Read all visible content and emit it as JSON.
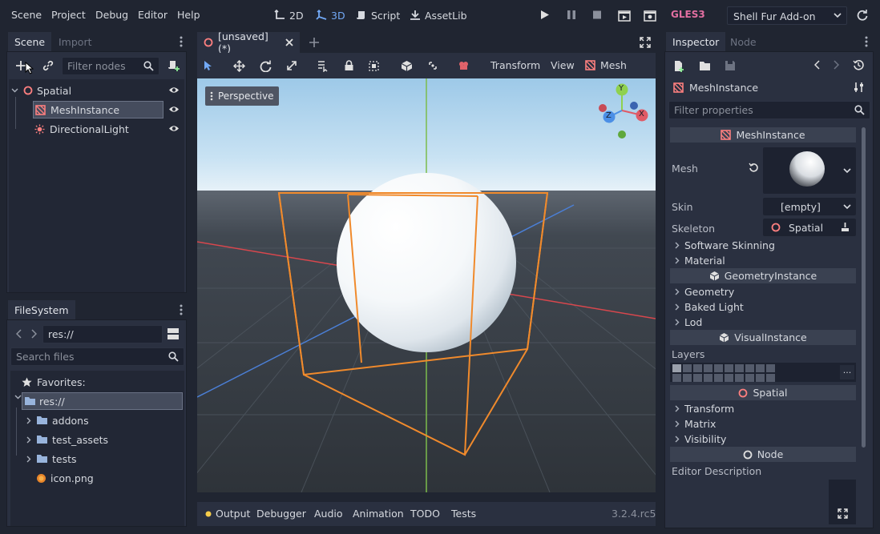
{
  "menu": [
    "Scene",
    "Project",
    "Debug",
    "Editor",
    "Help"
  ],
  "modes": {
    "m2d": "2D",
    "m3d": "3D",
    "script": "Script",
    "assetlib": "AssetLib"
  },
  "renderer": "GLES3",
  "plugin": "Shell Fur Add-on",
  "scene_dock": {
    "tabs": [
      "Scene",
      "Import"
    ],
    "filter_placeholder": "Filter nodes",
    "nodes": [
      "Spatial",
      "MeshInstance",
      "DirectionalLight"
    ]
  },
  "filesystem": {
    "tab": "FileSystem",
    "path": "res://",
    "search_placeholder": "Search files",
    "favorites": "Favorites:",
    "root": "res://",
    "items": [
      "addons",
      "test_assets",
      "tests",
      "icon.png"
    ]
  },
  "editor_tab": "[unsaved](*)",
  "viewport_menu": {
    "transform": "Transform",
    "view": "View",
    "mesh": "Mesh"
  },
  "perspective": "Perspective",
  "gizmo_axes": {
    "x": "X",
    "y": "Y",
    "z": "Z"
  },
  "bottom_tabs": [
    "Output",
    "Debugger",
    "Audio",
    "Animation",
    "TODO",
    "Tests"
  ],
  "version": "3.2.4.rc5",
  "inspector": {
    "tabs": [
      "Inspector",
      "Node"
    ],
    "object": "MeshInstance",
    "filter_placeholder": "Filter properties",
    "sections": {
      "mesh_instance": "MeshInstance",
      "geometry_instance": "GeometryInstance",
      "visual_instance": "VisualInstance",
      "spatial": "Spatial",
      "node": "Node"
    },
    "props": {
      "mesh": "Mesh",
      "skin": "Skin",
      "skin_value": "[empty]",
      "skeleton": "Skeleton",
      "skeleton_value": "Spatial",
      "layers": "Layers",
      "editor_description": "Editor Description"
    },
    "groups": {
      "software_skinning": "Software Skinning",
      "material": "Material",
      "geometry": "Geometry",
      "baked_light": "Baked Light",
      "lod": "Lod",
      "transform": "Transform",
      "matrix": "Matrix",
      "visibility": "Visibility"
    },
    "layers_more": "..."
  },
  "colors": {
    "accent": "#72a9f6",
    "node3d": "#fc7f7f",
    "renderer": "#e26fa1",
    "selection_box": "#f08a2c"
  }
}
